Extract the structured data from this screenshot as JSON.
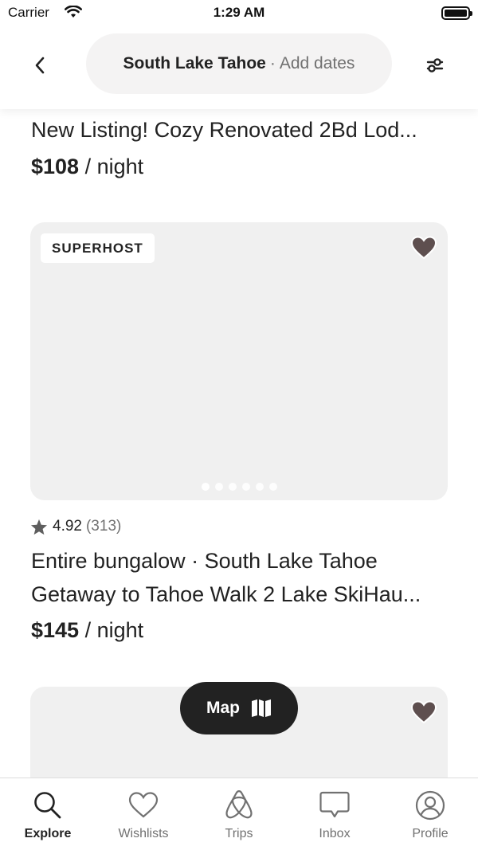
{
  "status_bar": {
    "carrier": "Carrier",
    "time": "1:29 AM"
  },
  "header": {
    "location": "South Lake Tahoe",
    "separator": "·",
    "dates_placeholder": "Add dates"
  },
  "listings": [
    {
      "title": "New Listing! Cozy Renovated 2Bd Lod...",
      "price": "$108",
      "price_unit": "/ night"
    },
    {
      "badge": "SUPERHOST",
      "photo_count": 6,
      "active_photo": 0,
      "rating": "4.92",
      "reviews": "(313)",
      "type_line": "Entire bungalow · South Lake Tahoe",
      "title": "Getaway to Tahoe Walk 2 Lake SkiHau...",
      "price": "$145",
      "price_unit": "/ night"
    }
  ],
  "map_button": {
    "label": "Map",
    "icon": "map-icon"
  },
  "tabs": [
    {
      "label": "Explore",
      "icon": "search-icon",
      "active": true
    },
    {
      "label": "Wishlists",
      "icon": "heart-icon",
      "active": false
    },
    {
      "label": "Trips",
      "icon": "airbnb-logo-icon",
      "active": false
    },
    {
      "label": "Inbox",
      "icon": "message-icon",
      "active": false
    },
    {
      "label": "Profile",
      "icon": "profile-icon",
      "active": false
    }
  ],
  "colors": {
    "text": "#222222",
    "secondary": "#717171",
    "pill": "#f4f3f3",
    "photo_placeholder": "#f0f0f0",
    "heart": "#5e4f4f"
  }
}
